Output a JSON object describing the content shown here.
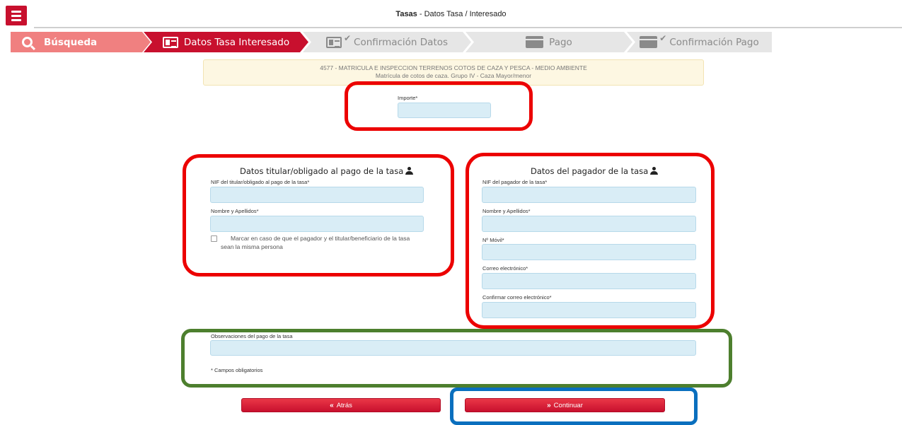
{
  "header": {
    "title_bold": "Tasas",
    "title_rest": " - Datos Tasa / Interesado",
    "menu_icon": "hamburger-icon"
  },
  "steps": [
    {
      "label": "Búsqueda",
      "icon": "search-icon",
      "state": "done"
    },
    {
      "label": "Datos Tasa Interesado",
      "icon": "id-card-icon",
      "state": "active"
    },
    {
      "label": "Confirmación Datos",
      "icon": "id-card-check-icon",
      "state": "pending"
    },
    {
      "label": "Pago",
      "icon": "credit-card-icon",
      "state": "pending"
    },
    {
      "label": "Confirmación Pago",
      "icon": "credit-card-check-icon",
      "state": "pending"
    }
  ],
  "info": {
    "line1": "4577  -  MATRICULA E INSPECCION TERRENOS COTOS DE CAZA Y PESCA  -  MEDIO AMBIENTE",
    "line2": "Matrícula de cotos de caza. Grupo IV - Caza Mayor/menor"
  },
  "importe": {
    "label": "Importe*",
    "value": ""
  },
  "titular": {
    "title": "Datos titular/obligado al pago de la tasa",
    "nif_label": "NIF del titular/obligado al pago de la tasa*",
    "nombre_label": "Nombre y Apellidos*",
    "checkbox_text": "Marcar en caso de que el pagador y el titular/beneficiario de la tasa sean la misma persona"
  },
  "pagador": {
    "title": "Datos del pagador de la tasa",
    "nif_label": "NIF del pagador de la tasa*",
    "nombre_label": "Nombre y Apellidos*",
    "movil_label": "Nº Móvil*",
    "correo_label": "Correo electrónico*",
    "confirmar_label": "Confirmar correo electrónico*"
  },
  "observaciones": {
    "label": "Observaciones del pago de la tasa",
    "required_note": "* Campos obligatorios"
  },
  "buttons": {
    "back": "Atrás",
    "continue": "Continuar",
    "back_arrow": "«",
    "continue_arrow": "»"
  },
  "colors": {
    "brand_red": "#c8102e",
    "search_step": "#f08080",
    "input_bg": "#d9edf6",
    "annotation_red": "#ec0000",
    "annotation_green": "#4d7f2e",
    "annotation_blue": "#0a6fbe"
  }
}
